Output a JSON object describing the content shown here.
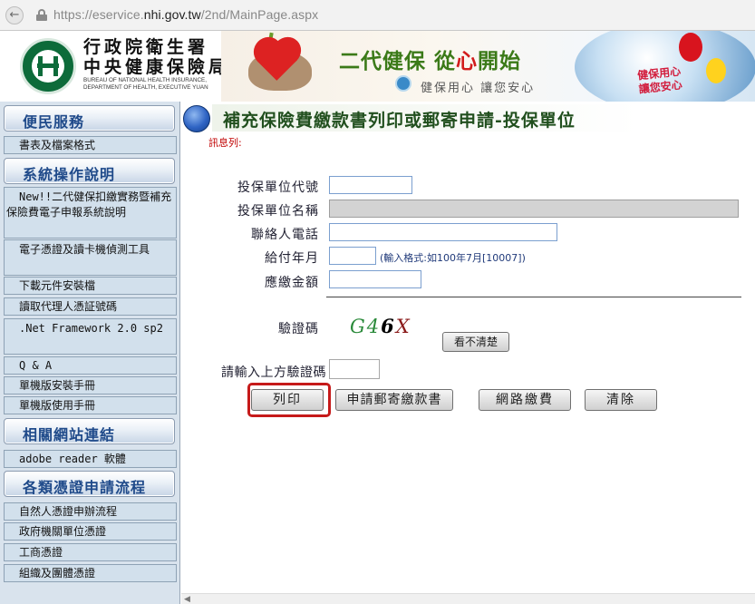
{
  "browser": {
    "url_prefix": "https://eservice.",
    "url_domain": "nhi.gov.tw",
    "url_path": "/2nd/MainPage.aspx"
  },
  "header": {
    "org_name_line1": "行政院衛生署",
    "org_name_line2": "中央健康保險局",
    "org_en_line1": "BUREAU OF NATIONAL HEALTH INSURANCE,",
    "org_en_line2": "DEPARTMENT OF HEALTH, EXECUTIVE YUAN",
    "slogan_part1": "二代健保 從",
    "slogan_heart": "心",
    "slogan_part2": "開始",
    "sub_slogan": "健保用心  讓您安心",
    "care_line1": "健保用心",
    "care_line2": "讓您安心"
  },
  "sidebar": {
    "sections": [
      {
        "title": "便民服務",
        "items": [
          "書表及檔案格式"
        ]
      },
      {
        "title": "系統操作說明",
        "items": [
          "New!!二代健保扣繳實務暨補充保險費電子申報系統說明",
          "電子憑證及讀卡機偵測工具",
          "下載元件安裝檔",
          "讀取代理人憑証號碼",
          ".Net Framework 2.0 sp2",
          "Q & A",
          "單機版安裝手冊",
          "單機版使用手冊"
        ]
      },
      {
        "title": "相關網站連結",
        "items": [
          "adobe reader 軟體"
        ]
      },
      {
        "title": "各類憑證申請流程",
        "items": [
          "自然人憑證申辦流程",
          "政府機關單位憑證",
          "工商憑證",
          "組織及團體憑證"
        ]
      }
    ]
  },
  "main": {
    "title": "補充保險費繳款書列印或郵寄申請-投保單位",
    "message_label": "訊息列:",
    "form": {
      "unit_code_label": "投保單位代號",
      "unit_code_value": "",
      "unit_name_label": "投保單位名稱",
      "unit_name_value": "",
      "phone_label": "聯絡人電話",
      "phone_value": "",
      "pay_month_label": "給付年月",
      "pay_month_value": "",
      "pay_month_hint": "(輸入格式:如100年7月[10007])",
      "amount_label": "應繳金額",
      "amount_value": ""
    },
    "captcha": {
      "label": "驗證碼",
      "chars": [
        "G4",
        "6",
        "X"
      ],
      "refresh_button": "看不清楚",
      "input_label": "請輸入上方驗證碼",
      "input_value": ""
    },
    "buttons": {
      "print": "列印",
      "mail_request": "申請郵寄繳款書",
      "online_pay": "網路繳費",
      "clear": "清除"
    }
  },
  "colors": {
    "sidebar_bg": "#d9e3ed",
    "section_title": "#1f4a8a",
    "page_title": "#214f1e",
    "highlight": "#c61a1a",
    "message_label": "#c00000"
  }
}
